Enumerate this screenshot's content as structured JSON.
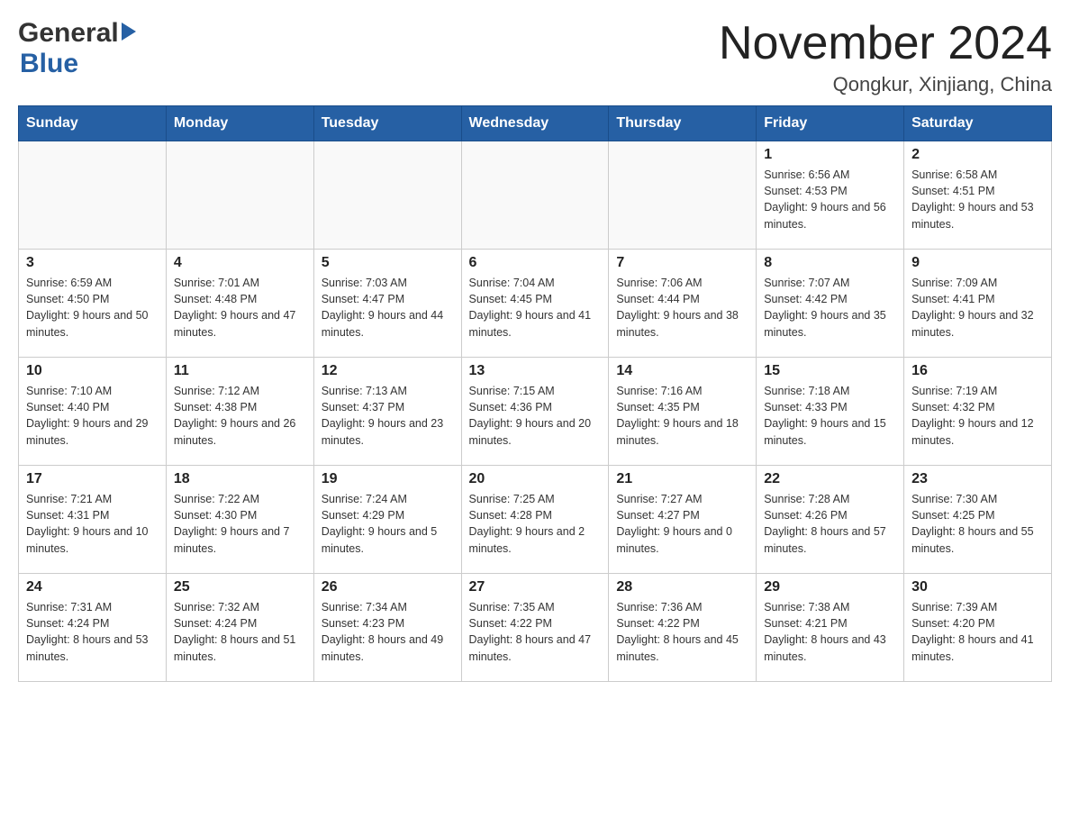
{
  "header": {
    "title": "November 2024",
    "location": "Qongkur, Xinjiang, China",
    "logo_general": "General",
    "logo_blue": "Blue"
  },
  "days_of_week": [
    "Sunday",
    "Monday",
    "Tuesday",
    "Wednesday",
    "Thursday",
    "Friday",
    "Saturday"
  ],
  "weeks": [
    [
      {
        "day": "",
        "info": ""
      },
      {
        "day": "",
        "info": ""
      },
      {
        "day": "",
        "info": ""
      },
      {
        "day": "",
        "info": ""
      },
      {
        "day": "",
        "info": ""
      },
      {
        "day": "1",
        "info": "Sunrise: 6:56 AM\nSunset: 4:53 PM\nDaylight: 9 hours and 56 minutes."
      },
      {
        "day": "2",
        "info": "Sunrise: 6:58 AM\nSunset: 4:51 PM\nDaylight: 9 hours and 53 minutes."
      }
    ],
    [
      {
        "day": "3",
        "info": "Sunrise: 6:59 AM\nSunset: 4:50 PM\nDaylight: 9 hours and 50 minutes."
      },
      {
        "day": "4",
        "info": "Sunrise: 7:01 AM\nSunset: 4:48 PM\nDaylight: 9 hours and 47 minutes."
      },
      {
        "day": "5",
        "info": "Sunrise: 7:03 AM\nSunset: 4:47 PM\nDaylight: 9 hours and 44 minutes."
      },
      {
        "day": "6",
        "info": "Sunrise: 7:04 AM\nSunset: 4:45 PM\nDaylight: 9 hours and 41 minutes."
      },
      {
        "day": "7",
        "info": "Sunrise: 7:06 AM\nSunset: 4:44 PM\nDaylight: 9 hours and 38 minutes."
      },
      {
        "day": "8",
        "info": "Sunrise: 7:07 AM\nSunset: 4:42 PM\nDaylight: 9 hours and 35 minutes."
      },
      {
        "day": "9",
        "info": "Sunrise: 7:09 AM\nSunset: 4:41 PM\nDaylight: 9 hours and 32 minutes."
      }
    ],
    [
      {
        "day": "10",
        "info": "Sunrise: 7:10 AM\nSunset: 4:40 PM\nDaylight: 9 hours and 29 minutes."
      },
      {
        "day": "11",
        "info": "Sunrise: 7:12 AM\nSunset: 4:38 PM\nDaylight: 9 hours and 26 minutes."
      },
      {
        "day": "12",
        "info": "Sunrise: 7:13 AM\nSunset: 4:37 PM\nDaylight: 9 hours and 23 minutes."
      },
      {
        "day": "13",
        "info": "Sunrise: 7:15 AM\nSunset: 4:36 PM\nDaylight: 9 hours and 20 minutes."
      },
      {
        "day": "14",
        "info": "Sunrise: 7:16 AM\nSunset: 4:35 PM\nDaylight: 9 hours and 18 minutes."
      },
      {
        "day": "15",
        "info": "Sunrise: 7:18 AM\nSunset: 4:33 PM\nDaylight: 9 hours and 15 minutes."
      },
      {
        "day": "16",
        "info": "Sunrise: 7:19 AM\nSunset: 4:32 PM\nDaylight: 9 hours and 12 minutes."
      }
    ],
    [
      {
        "day": "17",
        "info": "Sunrise: 7:21 AM\nSunset: 4:31 PM\nDaylight: 9 hours and 10 minutes."
      },
      {
        "day": "18",
        "info": "Sunrise: 7:22 AM\nSunset: 4:30 PM\nDaylight: 9 hours and 7 minutes."
      },
      {
        "day": "19",
        "info": "Sunrise: 7:24 AM\nSunset: 4:29 PM\nDaylight: 9 hours and 5 minutes."
      },
      {
        "day": "20",
        "info": "Sunrise: 7:25 AM\nSunset: 4:28 PM\nDaylight: 9 hours and 2 minutes."
      },
      {
        "day": "21",
        "info": "Sunrise: 7:27 AM\nSunset: 4:27 PM\nDaylight: 9 hours and 0 minutes."
      },
      {
        "day": "22",
        "info": "Sunrise: 7:28 AM\nSunset: 4:26 PM\nDaylight: 8 hours and 57 minutes."
      },
      {
        "day": "23",
        "info": "Sunrise: 7:30 AM\nSunset: 4:25 PM\nDaylight: 8 hours and 55 minutes."
      }
    ],
    [
      {
        "day": "24",
        "info": "Sunrise: 7:31 AM\nSunset: 4:24 PM\nDaylight: 8 hours and 53 minutes."
      },
      {
        "day": "25",
        "info": "Sunrise: 7:32 AM\nSunset: 4:24 PM\nDaylight: 8 hours and 51 minutes."
      },
      {
        "day": "26",
        "info": "Sunrise: 7:34 AM\nSunset: 4:23 PM\nDaylight: 8 hours and 49 minutes."
      },
      {
        "day": "27",
        "info": "Sunrise: 7:35 AM\nSunset: 4:22 PM\nDaylight: 8 hours and 47 minutes."
      },
      {
        "day": "28",
        "info": "Sunrise: 7:36 AM\nSunset: 4:22 PM\nDaylight: 8 hours and 45 minutes."
      },
      {
        "day": "29",
        "info": "Sunrise: 7:38 AM\nSunset: 4:21 PM\nDaylight: 8 hours and 43 minutes."
      },
      {
        "day": "30",
        "info": "Sunrise: 7:39 AM\nSunset: 4:20 PM\nDaylight: 8 hours and 41 minutes."
      }
    ]
  ]
}
